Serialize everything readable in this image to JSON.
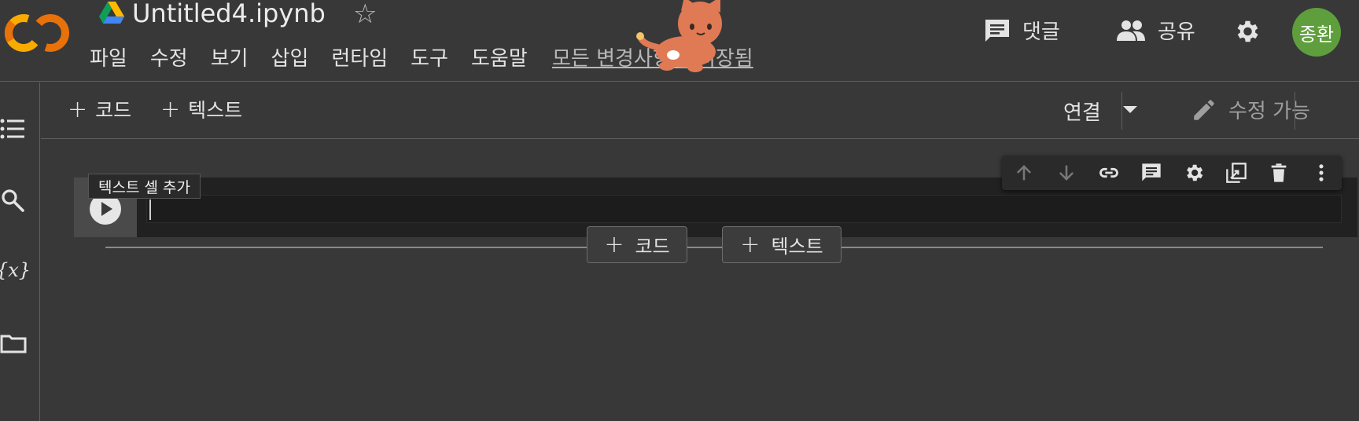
{
  "header": {
    "title": "Untitled4.ipynb",
    "menu": [
      "파일",
      "수정",
      "보기",
      "삽입",
      "런타임",
      "도구",
      "도움말"
    ],
    "saved_status": "모든 변경사항이 저장됨",
    "comments_label": "댓글",
    "share_label": "공유",
    "avatar_initials": "종환"
  },
  "toolbar": {
    "add_code_label": "코드",
    "add_text_label": "텍스트",
    "connect_label": "연결",
    "editable_label": "수정 가능"
  },
  "cell": {
    "tooltip": "텍스트 셀 추가",
    "code": ""
  },
  "add_cell": {
    "code_label": "코드",
    "text_label": "텍스트"
  },
  "icons": {
    "logo": "colab-logo",
    "drive": "google-drive-icon",
    "star": "star-icon",
    "comment": "comment-icon",
    "share": "people-icon",
    "settings": "gear-icon",
    "rail": [
      "toc-icon",
      "search-icon",
      "variables-icon",
      "folder-icon"
    ],
    "cell_toolbar": [
      "arrow-up-icon",
      "arrow-down-icon",
      "link-icon",
      "comment-icon",
      "gear-icon",
      "mirror-cell-icon",
      "delete-icon",
      "more-vert-icon"
    ]
  },
  "colors": {
    "background": "#383838",
    "avatar": "#5f9e3c",
    "logo_orange": "#f9ab00",
    "cell_bg": "#212121"
  }
}
